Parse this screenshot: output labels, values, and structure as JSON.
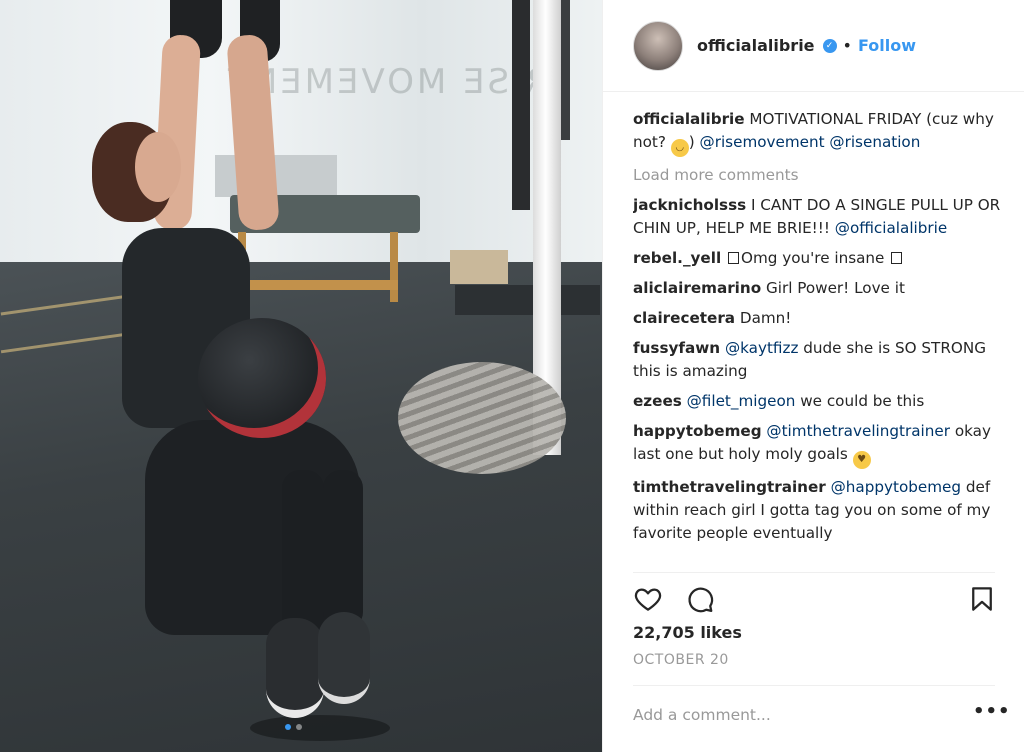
{
  "post": {
    "username": "officialalibrie",
    "follow_label": "Follow",
    "separator": "•",
    "caption": {
      "author": "officialalibrie",
      "text_before": "MOTIVATIONAL FRIDAY (cuz why not?",
      "mentions": [
        "@risemovement",
        "@risenation"
      ]
    },
    "load_more_label": "Load more comments",
    "comments": [
      {
        "author": "jacknicholsss",
        "text": "I CANT DO A SINGLE PULL UP OR CHIN UP, HELP ME BRIE!!!",
        "mention": "@officialalibrie"
      },
      {
        "author": "rebel._yell",
        "text": "Omg you're insane"
      },
      {
        "author": "aliclairemarino",
        "text": "Girl Power! Love it"
      },
      {
        "author": "clairecetera",
        "text": "Damn!"
      },
      {
        "author": "fussyfawn",
        "mention": "@kaytfizz",
        "text": "dude she is SO STRONG this is amazing"
      },
      {
        "author": "ezees",
        "mention": "@filet_migeon",
        "text": "we could be this"
      },
      {
        "author": "happytobemeg",
        "mention": "@timthetravelingtrainer",
        "text": "okay last one but holy moly goals"
      },
      {
        "author": "timthetravelingtrainer",
        "mention": "@happytobemeg",
        "text": "def within reach girl I gotta tag you on some of my favorite people eventually"
      }
    ],
    "likes": "22,705 likes",
    "date": "OCTOBER 20",
    "comment_placeholder": "Add a comment...",
    "more_options": "•••"
  },
  "photo": {
    "logo_text": "RISE MOVEMENT",
    "carousel_count": 2,
    "carousel_active": 0
  },
  "icons": {
    "verified": "verified-badge-icon",
    "heart": "heart-icon",
    "comment": "comment-bubble-icon",
    "save": "bookmark-icon",
    "more": "more-options-icon"
  },
  "colors": {
    "link_blue": "#3897f0",
    "mention_blue": "#003569",
    "muted_gray": "#999999",
    "text": "#262626"
  }
}
